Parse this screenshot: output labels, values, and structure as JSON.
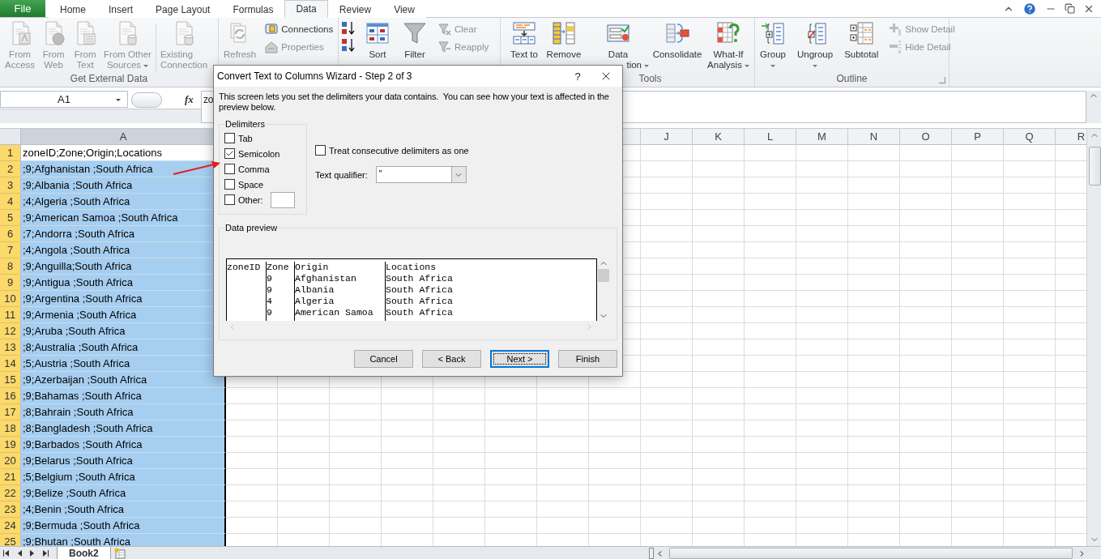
{
  "tabs": [
    {
      "label": "File",
      "kind": "file",
      "selected": false
    },
    {
      "label": "Home",
      "kind": "tab",
      "selected": false
    },
    {
      "label": "Insert",
      "kind": "tab",
      "selected": false
    },
    {
      "label": "Page Layout",
      "kind": "tab",
      "selected": false
    },
    {
      "label": "Formulas",
      "kind": "tab",
      "selected": false
    },
    {
      "label": "Data",
      "kind": "tab",
      "selected": true
    },
    {
      "label": "Review",
      "kind": "tab",
      "selected": false
    },
    {
      "label": "View",
      "kind": "tab",
      "selected": false
    }
  ],
  "ribbon": {
    "groups": [
      {
        "label": "Get External Data",
        "launcher": false,
        "items": [
          {
            "kind": "large",
            "lines": [
              "From",
              "Access"
            ],
            "disabled": true,
            "dropdown": false
          },
          {
            "kind": "large",
            "lines": [
              "From",
              "Web"
            ],
            "disabled": true,
            "dropdown": false
          },
          {
            "kind": "large",
            "lines": [
              "From",
              "Text"
            ],
            "disabled": true,
            "dropdown": false
          },
          {
            "kind": "large",
            "lines": [
              "From Other",
              "Sources"
            ],
            "disabled": true,
            "dropdown": true
          },
          {
            "kind": "separator"
          },
          {
            "kind": "large",
            "lines": [
              "Existing",
              "Connection"
            ],
            "disabled": true,
            "dropdown": false
          }
        ]
      },
      {
        "launcher": false,
        "items": [
          {
            "kind": "large",
            "lines": [
              "Refresh"
            ],
            "disabled": true,
            "dropdown": false
          },
          {
            "kind": "stack",
            "buttons": [
              {
                "label": "Connections",
                "disabled": false
              },
              {
                "label": "Properties",
                "disabled": true
              }
            ]
          }
        ]
      },
      {
        "launcher": false,
        "items": [
          {
            "kind": "sort_pair"
          },
          {
            "kind": "large",
            "lines": [
              "Sort"
            ],
            "disabled": false,
            "dropdown": false
          },
          {
            "kind": "large",
            "lines": [
              "Filter"
            ],
            "disabled": false,
            "dropdown": false
          },
          {
            "kind": "stack",
            "buttons": [
              {
                "label": "Clear",
                "disabled": true
              },
              {
                "label": "Reapply",
                "disabled": true
              }
            ]
          }
        ]
      },
      {
        "label": "Tools",
        "launcher": false,
        "items": [
          {
            "kind": "large",
            "lines": [
              "Text to"
            ],
            "disabled": false,
            "dropdown": false
          },
          {
            "kind": "large",
            "lines": [
              "Remove"
            ],
            "disabled": false,
            "dropdown": false
          },
          {
            "kind": "large",
            "lines": [
              "Data",
              "tion"
            ],
            "disabled": false,
            "dropdown": true
          },
          {
            "kind": "large",
            "lines": [
              "Consolidate"
            ],
            "disabled": false,
            "dropdown": false
          },
          {
            "kind": "large",
            "lines": [
              "What-If",
              "Analysis"
            ],
            "disabled": false,
            "dropdown": true
          }
        ]
      },
      {
        "label": "Outline",
        "launcher": true,
        "items": [
          {
            "kind": "large",
            "lines": [
              "Group"
            ],
            "disabled": false,
            "dropdown": true
          },
          {
            "kind": "large",
            "lines": [
              "Ungroup"
            ],
            "disabled": false,
            "dropdown": true
          },
          {
            "kind": "large",
            "lines": [
              "Subtotal"
            ],
            "disabled": false,
            "dropdown": false
          },
          {
            "kind": "stack",
            "buttons": [
              {
                "label": "Show Detail",
                "disabled": true
              },
              {
                "label": "Hide Detail",
                "disabled": true
              }
            ]
          }
        ]
      }
    ]
  },
  "formula_bar": {
    "name_box": "A1",
    "function_label": "fx",
    "content": "zo"
  },
  "sheet": {
    "columns": [
      {
        "label": "A",
        "selected": true
      },
      {
        "label": "J",
        "selected": false
      },
      {
        "label": "K",
        "selected": false
      },
      {
        "label": "L",
        "selected": false
      },
      {
        "label": "M",
        "selected": false
      },
      {
        "label": "N",
        "selected": false
      },
      {
        "label": "O",
        "selected": false
      },
      {
        "label": "P",
        "selected": false
      },
      {
        "label": "Q",
        "selected": false
      },
      {
        "label": "R",
        "selected": false
      }
    ],
    "rows": [
      {
        "number": "1",
        "cell_a": "zoneID;Zone;Origin;Locations",
        "active": true
      },
      {
        "number": "2",
        "cell_a": ";9;Afghanistan ;South Africa",
        "active": false
      },
      {
        "number": "3",
        "cell_a": ";9;Albania ;South Africa",
        "active": false
      },
      {
        "number": "4",
        "cell_a": ";4;Algeria ;South Africa",
        "active": false
      },
      {
        "number": "5",
        "cell_a": ";9;American Samoa ;South Africa",
        "active": false
      },
      {
        "number": "6",
        "cell_a": ";7;Andorra ;South Africa",
        "active": false
      },
      {
        "number": "7",
        "cell_a": ";4;Angola ;South Africa",
        "active": false
      },
      {
        "number": "8",
        "cell_a": ";9;Anguilla;South Africa",
        "active": false
      },
      {
        "number": "9",
        "cell_a": ";9;Antigua ;South Africa",
        "active": false
      },
      {
        "number": "10",
        "cell_a": ";9;Argentina ;South Africa",
        "active": false
      },
      {
        "number": "11",
        "cell_a": ";9;Armenia ;South Africa",
        "active": false
      },
      {
        "number": "12",
        "cell_a": ";9;Aruba ;South Africa",
        "active": false
      },
      {
        "number": "13",
        "cell_a": ";8;Australia ;South Africa",
        "active": false
      },
      {
        "number": "14",
        "cell_a": ";5;Austria ;South Africa",
        "active": false
      },
      {
        "number": "15",
        "cell_a": ";9;Azerbaijan ;South Africa",
        "active": false
      },
      {
        "number": "16",
        "cell_a": ";9;Bahamas ;South Africa",
        "active": false
      },
      {
        "number": "17",
        "cell_a": ";8;Bahrain ;South Africa",
        "active": false
      },
      {
        "number": "18",
        "cell_a": ";8;Bangladesh ;South Africa",
        "active": false
      },
      {
        "number": "19",
        "cell_a": ";9;Barbados ;South Africa",
        "active": false
      },
      {
        "number": "20",
        "cell_a": ";9;Belarus ;South Africa",
        "active": false
      },
      {
        "number": "21",
        "cell_a": ";5;Belgium ;South Africa",
        "active": false
      },
      {
        "number": "22",
        "cell_a": ";9;Belize ;South Africa",
        "active": false
      },
      {
        "number": "23",
        "cell_a": ";4;Benin ;South Africa",
        "active": false
      },
      {
        "number": "24",
        "cell_a": ";9;Bermuda ;South Africa",
        "active": false
      },
      {
        "number": "25",
        "cell_a": ";9;Bhutan ;South Africa",
        "active": false
      }
    ]
  },
  "sheet_tabs": [
    {
      "label": "Book2",
      "selected": true
    }
  ],
  "dialog": {
    "title": "Convert Text to Columns Wizard - Step 2 of 3",
    "help": "?",
    "description": "This screen lets you set the delimiters your data contains.  You can see how your text is affected in the preview below.",
    "delimiters": {
      "label": "Delimiters",
      "options": [
        {
          "label": "Tab",
          "checked": false
        },
        {
          "label": "Semicolon",
          "checked": true
        },
        {
          "label": "Comma",
          "checked": false
        },
        {
          "label": "Space",
          "checked": false
        }
      ],
      "other": {
        "label": "Other:",
        "checked": false
      }
    },
    "treat_consecutive": {
      "label": "Treat consecutive delimiters as one",
      "checked": false
    },
    "text_qualifier": {
      "label": "Text qualifier:",
      "value": "\""
    },
    "preview": {
      "label": "Data preview",
      "header": [
        "zoneID",
        "Zone",
        "Origin",
        "Locations"
      ],
      "rows": [
        {
          "zone": "9",
          "origin": "Afghanistan",
          "location": "South Africa"
        },
        {
          "zone": "9",
          "origin": "Albania",
          "location": "South Africa"
        },
        {
          "zone": "4",
          "origin": "Algeria",
          "location": "South Africa"
        },
        {
          "zone": "9",
          "origin": "American Samoa",
          "location": "South Africa"
        }
      ]
    },
    "buttons": [
      {
        "label": "Cancel",
        "default": false
      },
      {
        "label": "< Back",
        "default": false
      },
      {
        "label": "Next >",
        "default": true
      },
      {
        "label": "Finish",
        "default": false
      }
    ]
  }
}
